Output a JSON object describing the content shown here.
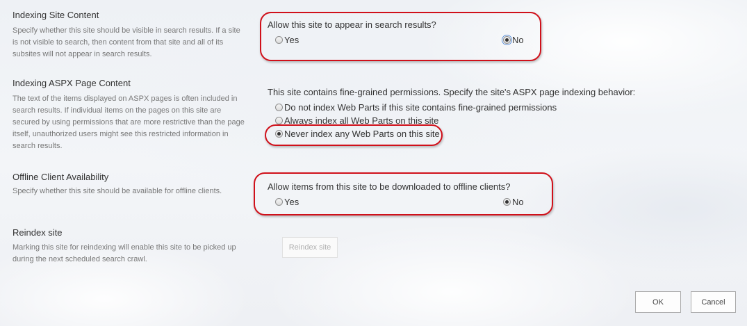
{
  "indexing_site_content": {
    "title": "Indexing Site Content",
    "description": "Specify whether this site should be visible in search results. If a site is not visible to search, then content from that site and all of its subsites will not appear in search results.",
    "question": "Allow this site to appear in search results?",
    "options": [
      "Yes",
      "No"
    ],
    "selected": "No"
  },
  "indexing_aspx": {
    "title": "Indexing ASPX Page Content",
    "description": "The text of the items displayed on ASPX pages is often included in search results. If individual items on the pages on this site are secured by using permissions that are more restrictive than the page itself, unauthorized users might see this restricted information in search results.",
    "question": "This site contains fine-grained permissions. Specify the site's ASPX page indexing behavior:",
    "options": [
      "Do not index Web Parts if this site contains fine-grained permissions",
      "Always index all Web Parts on this site",
      "Never index any Web Parts on this site"
    ],
    "selected": "Never index any Web Parts on this site"
  },
  "offline_client": {
    "title": "Offline Client Availability",
    "description": "Specify whether this site should be available for offline clients.",
    "question": "Allow items from this site to be downloaded to offline clients?",
    "options": [
      "Yes",
      "No"
    ],
    "selected": "No"
  },
  "reindex_site": {
    "title": "Reindex site",
    "description": "Marking this site for reindexing will enable this site to be picked up during the next scheduled search crawl.",
    "button_label": "Reindex site"
  },
  "footer": {
    "ok_label": "OK",
    "cancel_label": "Cancel"
  },
  "colors": {
    "highlight": "#d0101a",
    "text": "#333333",
    "description_text": "#777777"
  }
}
